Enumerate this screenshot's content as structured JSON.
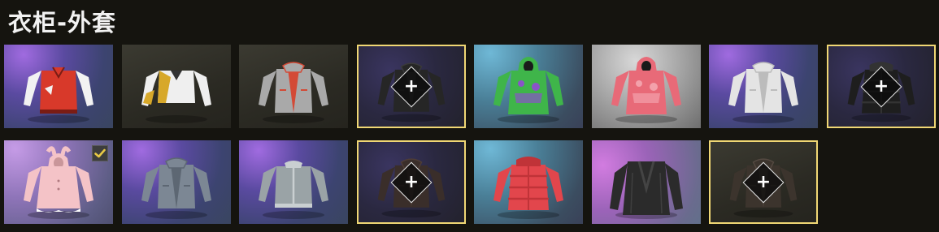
{
  "title": "衣柜-外套",
  "colors": {
    "selected_border": "#f0d774",
    "check_mark": "#e8c945",
    "background": "#15140f"
  },
  "items": [
    {
      "name": "red-varsity-jacket",
      "bg": "purple",
      "jacket_color": "#d8392a",
      "accent": "#f2f2f2",
      "style": "varsity",
      "equipped": false,
      "slot_frame": false,
      "add_icon": false
    },
    {
      "name": "white-gold-jacket",
      "bg": "dark",
      "jacket_color": "#efefef",
      "accent": "#d7a82a",
      "style": "cropped",
      "equipped": false,
      "slot_frame": false,
      "add_icon": false
    },
    {
      "name": "grey-hooded-jacket",
      "bg": "dark",
      "jacket_color": "#a9a9a9",
      "accent": "#d34a36",
      "style": "open",
      "equipped": false,
      "slot_frame": false,
      "add_icon": false
    },
    {
      "name": "dark-jacket-slot",
      "bg": "navy",
      "jacket_color": "#262626",
      "accent": "#3a3a3a",
      "style": "open",
      "equipped": false,
      "slot_frame": true,
      "add_icon": true
    },
    {
      "name": "graffiti-hoodie",
      "bg": "teal",
      "jacket_color": "#3fb54a",
      "accent": "#8a53c8",
      "style": "hoodie",
      "equipped": false,
      "slot_frame": false,
      "add_icon": false
    },
    {
      "name": "pink-hoodie",
      "bg": "light",
      "jacket_color": "#e86a78",
      "accent": "#f3a1ab",
      "style": "hoodie",
      "equipped": false,
      "slot_frame": false,
      "add_icon": false
    },
    {
      "name": "white-shirt-jacket",
      "bg": "purple",
      "jacket_color": "#e4e4e4",
      "accent": "#bcbcbc",
      "style": "open",
      "equipped": false,
      "slot_frame": false,
      "add_icon": false
    },
    {
      "name": "black-puffer-slot",
      "bg": "navy",
      "jacket_color": "#1e1e1e",
      "accent": "#333333",
      "style": "puffer",
      "equipped": false,
      "slot_frame": true,
      "add_icon": true
    },
    {
      "name": "pink-bunny-hoodie",
      "bg": "lilac",
      "jacket_color": "#f4c3c7",
      "accent": "#ffffff",
      "style": "dress",
      "equipped": true,
      "slot_frame": false,
      "add_icon": false
    },
    {
      "name": "denim-jacket",
      "bg": "purple",
      "jacket_color": "#7c8794",
      "accent": "#5d6773",
      "style": "open",
      "equipped": false,
      "slot_frame": false,
      "add_icon": false
    },
    {
      "name": "grey-bomber-jacket",
      "bg": "purple",
      "jacket_color": "#9aa3a6",
      "accent": "#c9cfd1",
      "style": "bomber",
      "equipped": false,
      "slot_frame": false,
      "add_icon": false
    },
    {
      "name": "brown-leather-slot",
      "bg": "navy",
      "jacket_color": "#3a2e2a",
      "accent": "#4f3d36",
      "style": "open",
      "equipped": false,
      "slot_frame": true,
      "add_icon": true
    },
    {
      "name": "red-puffer-jacket",
      "bg": "teal",
      "jacket_color": "#e2464c",
      "accent": "#c03338",
      "style": "puffer",
      "equipped": false,
      "slot_frame": false,
      "add_icon": false
    },
    {
      "name": "black-fur-coat",
      "bg": "pink",
      "jacket_color": "#2b2b2b",
      "accent": "#444444",
      "style": "coat",
      "equipped": false,
      "slot_frame": false,
      "add_icon": false
    },
    {
      "name": "brown-coat-slot",
      "bg": "dark",
      "jacket_color": "#3c342d",
      "accent": "#544941",
      "style": "open",
      "equipped": false,
      "slot_frame": true,
      "add_icon": true
    }
  ]
}
